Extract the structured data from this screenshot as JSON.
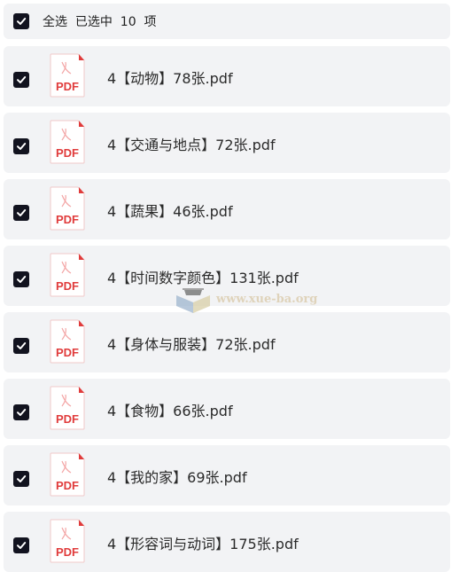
{
  "header": {
    "select_all_text": "全选  已选中  10  项"
  },
  "files": [
    {
      "name": "4【动物】78张.pdf",
      "checked": true,
      "icon": "pdf-file-icon"
    },
    {
      "name": "4【交通与地点】72张.pdf",
      "checked": true,
      "icon": "pdf-file-icon"
    },
    {
      "name": "4【蔬果】46张.pdf",
      "checked": true,
      "icon": "pdf-file-icon"
    },
    {
      "name": "4【时间数字颜色】131张.pdf",
      "checked": true,
      "icon": "pdf-file-icon"
    },
    {
      "name": "4【身体与服装】72张.pdf",
      "checked": true,
      "icon": "pdf-file-icon"
    },
    {
      "name": "4【食物】66张.pdf",
      "checked": true,
      "icon": "pdf-file-icon"
    },
    {
      "name": "4【我的家】69张.pdf",
      "checked": true,
      "icon": "pdf-file-icon"
    },
    {
      "name": "4【形容词与动词】175张.pdf",
      "checked": true,
      "icon": "pdf-file-icon"
    }
  ],
  "pdf_icon_label": "PDF",
  "watermark": {
    "text": "www.xue-ba.org"
  },
  "colors": {
    "row_background": "#f2f3f5",
    "checkbox": "#12131f",
    "pdf_red": "#e03b3b"
  }
}
